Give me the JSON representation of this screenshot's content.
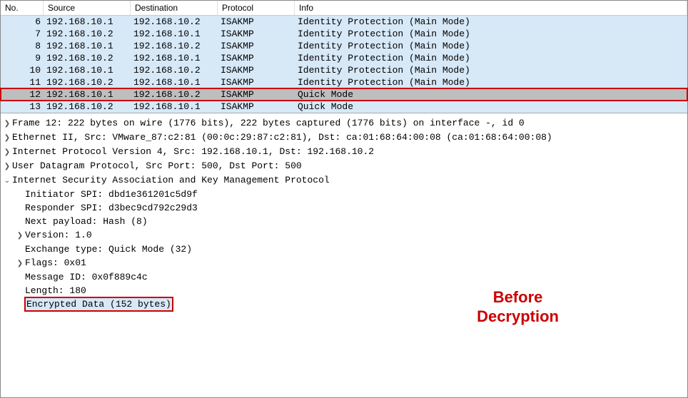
{
  "columns": {
    "no": "No.",
    "source": "Source",
    "destination": "Destination",
    "protocol": "Protocol",
    "info": "Info"
  },
  "packets": [
    {
      "no": "6",
      "source": "192.168.10.1",
      "dest": "192.168.10.2",
      "protocol": "ISAKMP",
      "info": "Identity Protection (Main Mode)",
      "selected": false
    },
    {
      "no": "7",
      "source": "192.168.10.2",
      "dest": "192.168.10.1",
      "protocol": "ISAKMP",
      "info": "Identity Protection (Main Mode)",
      "selected": false
    },
    {
      "no": "8",
      "source": "192.168.10.1",
      "dest": "192.168.10.2",
      "protocol": "ISAKMP",
      "info": "Identity Protection (Main Mode)",
      "selected": false
    },
    {
      "no": "9",
      "source": "192.168.10.2",
      "dest": "192.168.10.1",
      "protocol": "ISAKMP",
      "info": "Identity Protection (Main Mode)",
      "selected": false
    },
    {
      "no": "10",
      "source": "192.168.10.1",
      "dest": "192.168.10.2",
      "protocol": "ISAKMP",
      "info": "Identity Protection (Main Mode)",
      "selected": false
    },
    {
      "no": "11",
      "source": "192.168.10.2",
      "dest": "192.168.10.1",
      "protocol": "ISAKMP",
      "info": "Identity Protection (Main Mode)",
      "selected": false
    },
    {
      "no": "12",
      "source": "192.168.10.1",
      "dest": "192.168.10.2",
      "protocol": "ISAKMP",
      "info": "Quick Mode",
      "selected": true
    },
    {
      "no": "13",
      "source": "192.168.10.2",
      "dest": "192.168.10.1",
      "protocol": "ISAKMP",
      "info": "Quick Mode",
      "selected": false
    }
  ],
  "details": {
    "frame": "Frame 12: 222 bytes on wire (1776 bits), 222 bytes captured (1776 bits) on interface -, id 0",
    "eth": "Ethernet II, Src: VMware_87:c2:81 (00:0c:29:87:c2:81), Dst: ca:01:68:64:00:08 (ca:01:68:64:00:08)",
    "ip": "Internet Protocol Version 4, Src: 192.168.10.1, Dst: 192.168.10.2",
    "udp": "User Datagram Protocol, Src Port: 500, Dst Port: 500",
    "isakmp": "Internet Security Association and Key Management Protocol",
    "init_spi": "Initiator SPI: dbd1e361201c5d9f",
    "resp_spi": "Responder SPI: d3bec9cd792c29d3",
    "next_pl": "Next payload: Hash (8)",
    "version": "Version: 1.0",
    "exch": "Exchange type: Quick Mode (32)",
    "flags": "Flags: 0x01",
    "msg_id": "Message ID: 0x0f889c4c",
    "length": "Length: 180",
    "enc": "Encrypted Data (152 bytes)"
  },
  "annotation": {
    "line1": "Before",
    "line2": "Decryption"
  },
  "glyphs": {
    "collapsed": "❯",
    "expanded": "⌄"
  }
}
